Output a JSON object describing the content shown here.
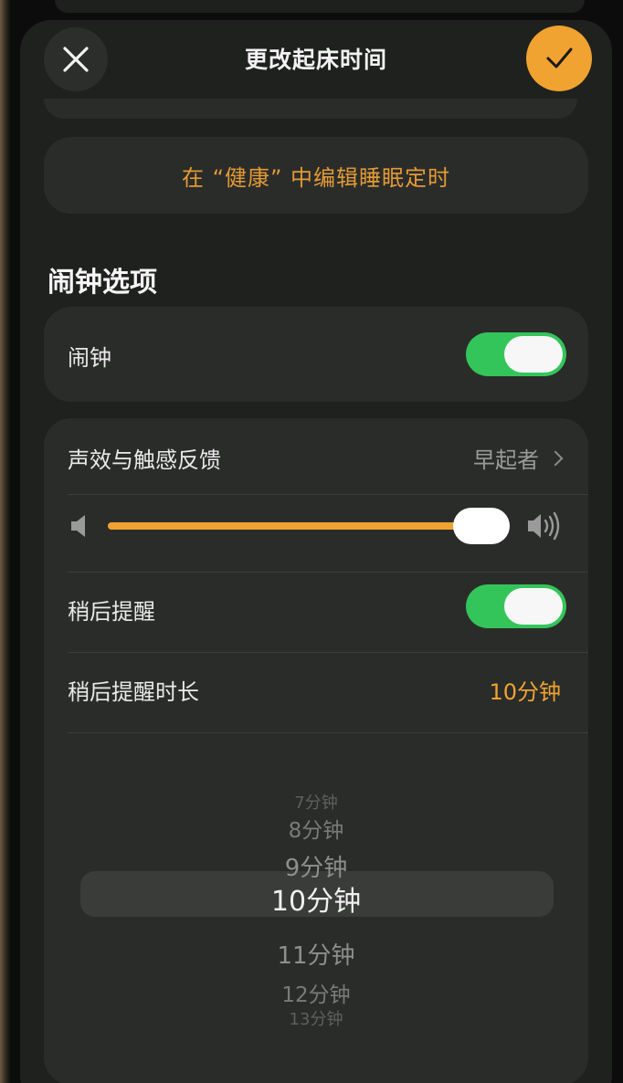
{
  "header": {
    "title": "更改起床时间",
    "close_icon": "close-icon",
    "confirm_icon": "checkmark-icon"
  },
  "health_link": "在 “健康” 中编辑睡眠定时",
  "section_title": "闹钟选项",
  "alarm": {
    "label": "闹钟",
    "enabled": true
  },
  "sound": {
    "label": "声效与触感反馈",
    "value": "早起者"
  },
  "volume": {
    "level_percent": 100
  },
  "snooze": {
    "label": "稍后提醒",
    "enabled": true
  },
  "snooze_duration": {
    "label": "稍后提醒时长",
    "value": "10分钟",
    "options": [
      "7分钟",
      "8分钟",
      "9分钟",
      "10分钟",
      "11分钟",
      "12分钟",
      "13分钟"
    ]
  },
  "colors": {
    "accent": "#f0a330",
    "toggle_on": "#34c55a",
    "card_bg": "#2a2c2a"
  }
}
